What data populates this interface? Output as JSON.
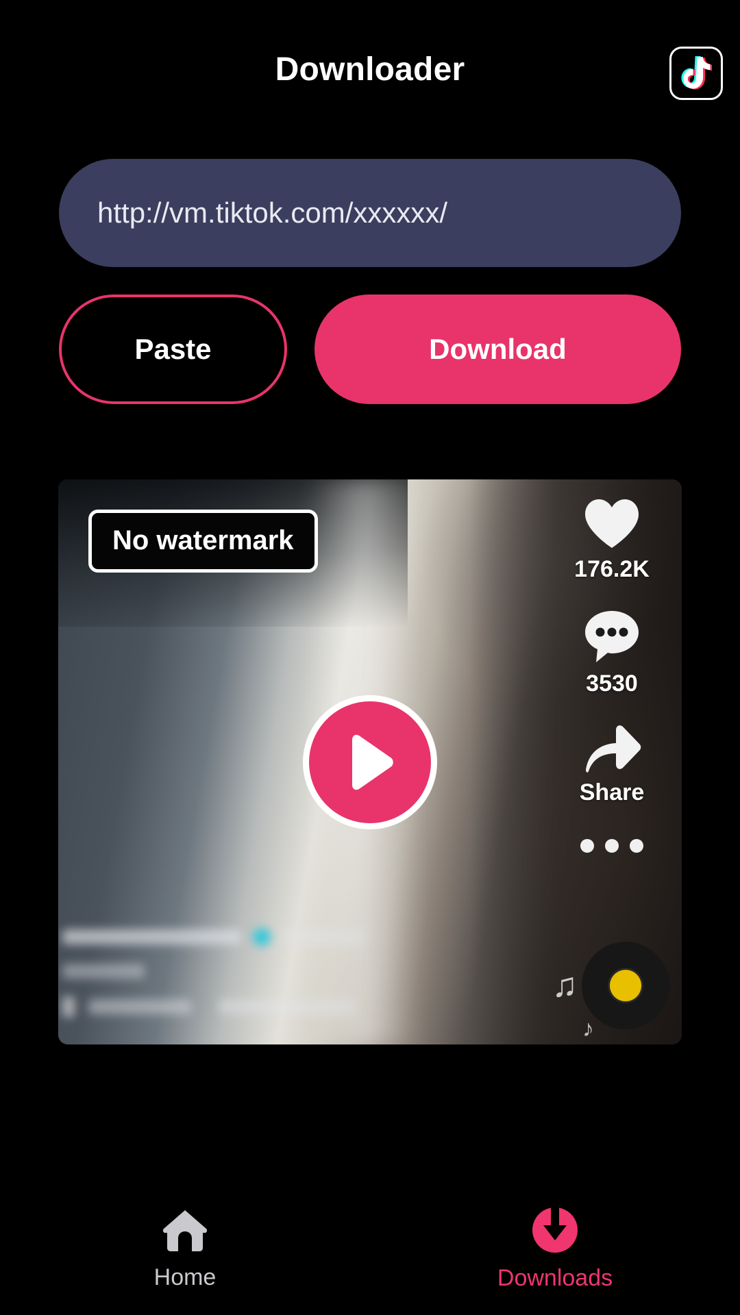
{
  "header": {
    "title": "Downloader",
    "badge_icon": "tiktok-logo-icon"
  },
  "url_input": {
    "value": "http://vm.tiktok.com/xxxxxx/",
    "placeholder": "http://vm.tiktok.com/xxxxxx/"
  },
  "actions": {
    "paste_label": "Paste",
    "download_label": "Download"
  },
  "video_card": {
    "badge_label": "No watermark",
    "play_icon": "play-icon",
    "rail": {
      "like_icon": "heart-icon",
      "like_count": "176.2K",
      "comment_icon": "comment-bubble-icon",
      "comment_count": "3530",
      "share_icon": "share-arrow-icon",
      "share_label": "Share",
      "more_icon": "more-dots-icon",
      "music_disc_icon": "vinyl-disc-icon",
      "music_note_icon": "music-note-icon"
    }
  },
  "bottom_nav": {
    "items": [
      {
        "label": "Home",
        "icon": "home-icon",
        "active": false
      },
      {
        "label": "Downloads",
        "icon": "download-circle-icon",
        "active": true
      }
    ]
  },
  "colors": {
    "accent_pink": "#E8346B",
    "nav_active_pink": "#F0356F",
    "input_bg": "#3B3E5E",
    "page_bg": "#000000",
    "disc_center_yellow": "#E8C000",
    "verified_cyan": "#1BC8DC"
  }
}
